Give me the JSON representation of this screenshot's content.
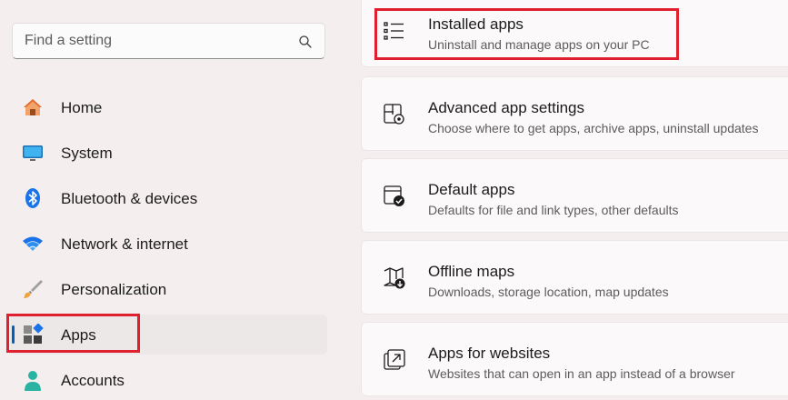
{
  "search": {
    "placeholder": "Find a setting",
    "icon": "search-icon"
  },
  "sidebar": {
    "items": [
      {
        "label": "Home",
        "icon": "home-icon"
      },
      {
        "label": "System",
        "icon": "system-icon"
      },
      {
        "label": "Bluetooth & devices",
        "icon": "bluetooth-icon"
      },
      {
        "label": "Network & internet",
        "icon": "wifi-icon"
      },
      {
        "label": "Personalization",
        "icon": "brush-icon"
      },
      {
        "label": "Apps",
        "icon": "apps-icon",
        "selected": true
      },
      {
        "label": "Accounts",
        "icon": "account-icon"
      }
    ]
  },
  "main": {
    "cards": [
      {
        "title": "Installed apps",
        "desc": "Uninstall and manage apps on your PC",
        "icon": "list-icon"
      },
      {
        "title": "Advanced app settings",
        "desc": "Choose where to get apps, archive apps, uninstall updates",
        "icon": "app-settings-icon"
      },
      {
        "title": "Default apps",
        "desc": "Defaults for file and link types, other defaults",
        "icon": "default-apps-icon"
      },
      {
        "title": "Offline maps",
        "desc": "Downloads, storage location, map updates",
        "icon": "map-icon"
      },
      {
        "title": "Apps for websites",
        "desc": "Websites that can open in an app instead of a browser",
        "icon": "open-external-icon"
      }
    ]
  },
  "colors": {
    "accent": "#005fb8",
    "highlight": "#e0202e",
    "background": "#f4efee"
  }
}
